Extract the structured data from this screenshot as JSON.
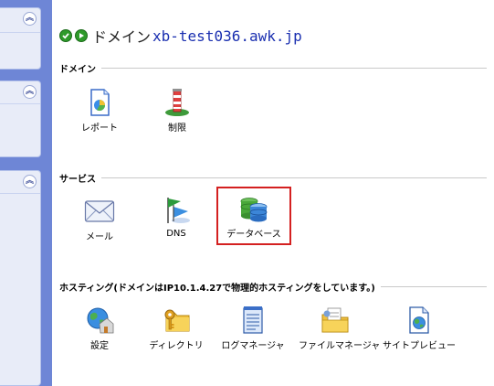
{
  "title": {
    "label": "ドメイン",
    "domain": "xb-test036.awk.jp"
  },
  "sections": {
    "domain": {
      "label": "ドメイン",
      "items": [
        {
          "label": "レポート",
          "icon": "report-icon"
        },
        {
          "label": "制限",
          "icon": "limits-icon"
        }
      ]
    },
    "services": {
      "label": "サービス",
      "items": [
        {
          "label": "メール",
          "icon": "mail-icon"
        },
        {
          "label": "DNS",
          "icon": "dns-flag-icon"
        },
        {
          "label": "データベース",
          "icon": "database-icon"
        }
      ]
    },
    "hosting": {
      "label": "ホスティング(ドメインはIP10.1.4.27で物理的ホスティングをしています。)",
      "items": [
        {
          "label": "設定",
          "icon": "settings-globe-icon"
        },
        {
          "label": "ディレクトリ",
          "icon": "folder-key-icon"
        },
        {
          "label": "ログマネージャ",
          "icon": "log-document-icon"
        },
        {
          "label": "ファイルマネージャ",
          "icon": "file-manager-icon"
        },
        {
          "label": "サイトプレビュー",
          "icon": "site-preview-icon"
        }
      ]
    }
  },
  "colors": {
    "sidebar": "#6e86d6",
    "highlight": "#d42020",
    "domain_link": "#1a2fb0"
  }
}
